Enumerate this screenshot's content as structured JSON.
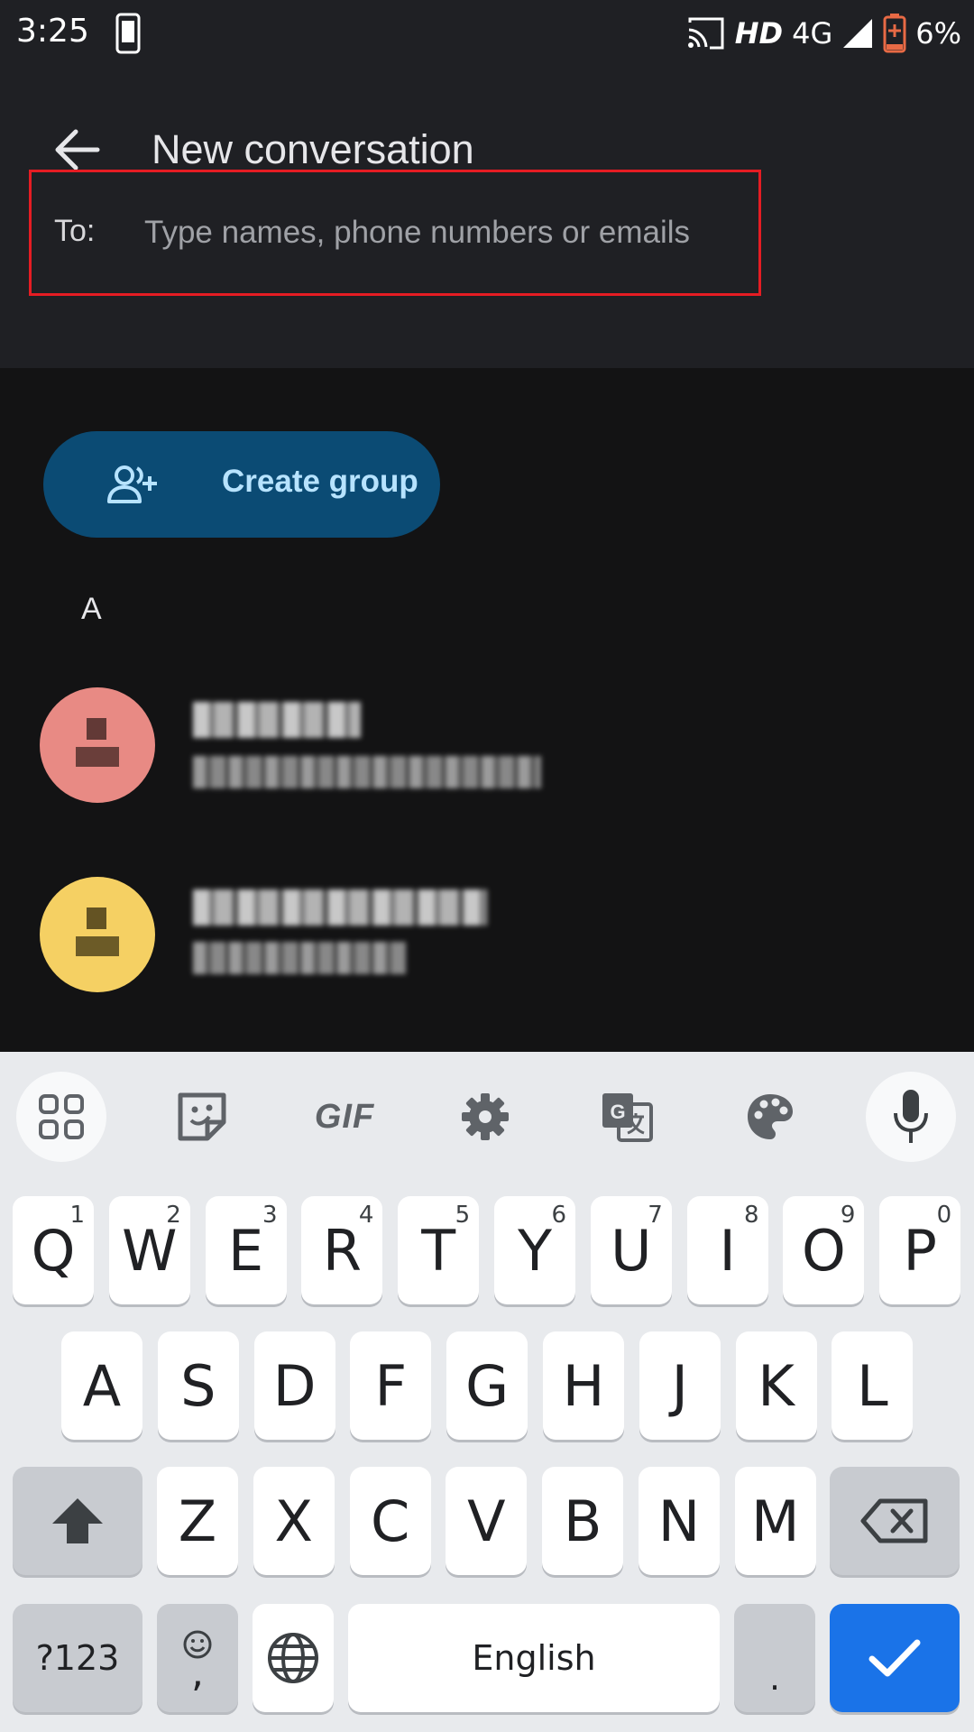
{
  "status_bar": {
    "time": "3:25",
    "network_hd": "HD",
    "network_type": "4G",
    "battery": "6%"
  },
  "app_bar": {
    "title": "New conversation"
  },
  "recipient_field": {
    "label": "To:",
    "placeholder": "Type names, phone numbers or emails",
    "value": ""
  },
  "create_group": {
    "label": "Create group"
  },
  "contacts": {
    "section_letter": "A",
    "items": [
      {
        "avatar_color": "#e88a84"
      },
      {
        "avatar_color": "#f5d063"
      }
    ]
  },
  "keyboard_toolbar": {
    "gif_label": "GIF"
  },
  "keyboard": {
    "row1": [
      {
        "key": "Q",
        "hint": "1"
      },
      {
        "key": "W",
        "hint": "2"
      },
      {
        "key": "E",
        "hint": "3"
      },
      {
        "key": "R",
        "hint": "4"
      },
      {
        "key": "T",
        "hint": "5"
      },
      {
        "key": "Y",
        "hint": "6"
      },
      {
        "key": "U",
        "hint": "7"
      },
      {
        "key": "I",
        "hint": "8"
      },
      {
        "key": "O",
        "hint": "9"
      },
      {
        "key": "P",
        "hint": "0"
      }
    ],
    "row2": [
      "A",
      "S",
      "D",
      "F",
      "G",
      "H",
      "J",
      "K",
      "L"
    ],
    "row3": [
      "Z",
      "X",
      "C",
      "V",
      "B",
      "N",
      "M"
    ],
    "symbols_label": "?123",
    "emoji_comma_label": ",",
    "space_label": "English",
    "period_label": "."
  },
  "colors": {
    "accent_blue": "#1a73e8",
    "create_group_bg": "#0b4b74",
    "highlight_border": "#e51c23"
  }
}
